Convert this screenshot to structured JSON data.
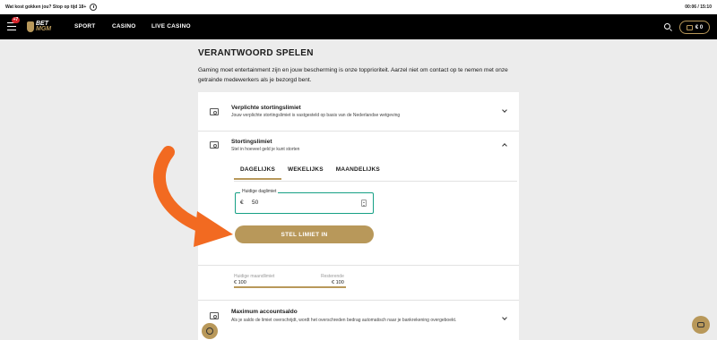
{
  "infobar": {
    "message": "Wat kost gokken jou? Stop op tijd 18+",
    "session_time": "00:06 / 15:10"
  },
  "nav": {
    "badge_count": "+7",
    "logo_top": "BET",
    "logo_bottom": "MGM",
    "items": [
      {
        "label": "SPORT"
      },
      {
        "label": "CASINO"
      },
      {
        "label": "LIVE CASINO"
      }
    ],
    "balance": "€ 0"
  },
  "page": {
    "title": "VERANTWOORD SPELEN",
    "intro": "Gaming moet entertainment zijn en jouw bescherming is onze topprioriteit. Aarzel niet om contact op te nemen met onze getrainde medewerkers als je bezorgd bent."
  },
  "sections": {
    "mandatory": {
      "title": "Verplichte stortingslimiet",
      "subtitle": "Jouw verplichte stortingslimiet is vastgesteld op basis van de Nederlandse wetgeving"
    },
    "deposit": {
      "title": "Stortingslimiet",
      "subtitle": "Stel in hoeveel geld je kunt storten",
      "tabs": [
        {
          "label": "DAGELIJKS",
          "active": true
        },
        {
          "label": "WEKELIJKS"
        },
        {
          "label": "MAANDELIJKS"
        }
      ],
      "input_label": "Huidige daglimiet",
      "currency": "€",
      "value": "50",
      "button_label": "STEL LIMIET IN",
      "summary_left_label": "Huidige maandlimiet",
      "summary_left_value": "€ 100",
      "summary_right_label": "Resterende",
      "summary_right_value": "€ 100",
      "summary_used_fraction": 0
    },
    "max_balance": {
      "title": "Maximum accountsaldo",
      "subtitle": "Als je saldo de limiet overschrijdt, wordt het overschreden bedrag automatisch naar je bankrekening overgeboekt."
    }
  },
  "colors": {
    "accent": "#b8985a",
    "input_focus": "#16a085",
    "arrow": "#f26a21",
    "navbar": "#000000"
  }
}
